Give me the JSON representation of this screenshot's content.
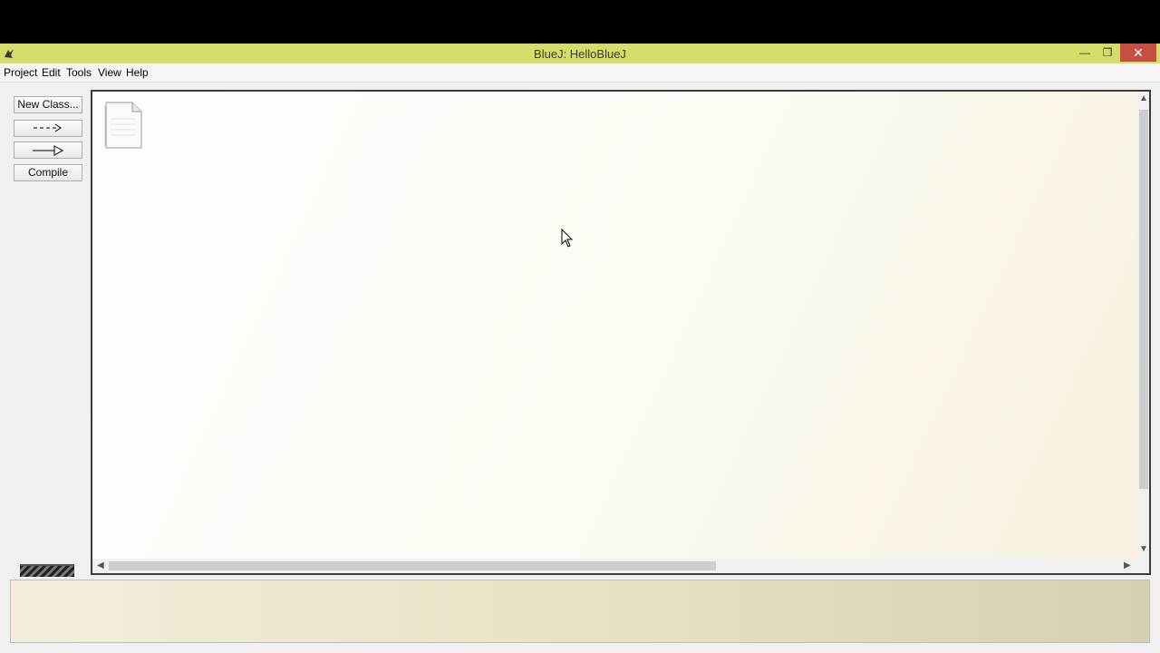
{
  "window": {
    "title": "BlueJ:  HelloBlueJ"
  },
  "menu": [
    "Project",
    "Edit",
    "Tools",
    "View",
    "Help"
  ],
  "toolbar": {
    "new_class_label": "New Class...",
    "compile_label": "Compile"
  },
  "status": {
    "text": ""
  },
  "colors": {
    "titlebar": "#d4dc6a",
    "close_button": "#c74f42",
    "status_area": "#e7e0c2"
  },
  "icons": [
    "bluej-app-icon",
    "minimize-icon",
    "maximize-icon",
    "close-icon",
    "dashed-arrow-icon",
    "solid-arrow-icon",
    "readme-document-icon"
  ]
}
